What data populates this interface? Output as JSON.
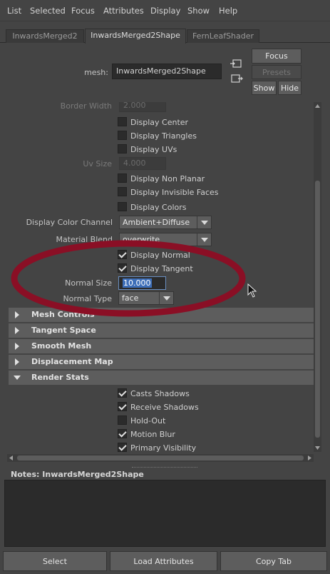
{
  "menubar": {
    "items": [
      "List",
      "Selected",
      "Focus",
      "Attributes",
      "Display",
      "Show",
      "Help"
    ]
  },
  "tabs": [
    "InwardsMerged2",
    "InwardsMerged2Shape",
    "FernLeafShader"
  ],
  "mesh": {
    "label": "mesh:",
    "value": "InwardsMerged2Shape"
  },
  "buttons": {
    "focus": "Focus",
    "presets": "Presets",
    "show": "Show",
    "hide": "Hide"
  },
  "attrs": {
    "border_width_label": "Border Width",
    "border_width_value": "2.000",
    "display_center": "Display Center",
    "display_triangles": "Display Triangles",
    "display_uvs": "Display UVs",
    "uv_size_label": "Uv Size",
    "uv_size_value": "4.000",
    "display_non_planar": "Display Non Planar",
    "display_invisible_faces": "Display Invisible Faces",
    "display_colors": "Display Colors",
    "display_color_channel_label": "Display Color Channel",
    "display_color_channel_value": "Ambient+Diffuse",
    "material_blend_label": "Material Blend",
    "material_blend_value": "overwrite",
    "display_normal": "Display Normal",
    "display_tangent": "Display Tangent",
    "normal_size_label": "Normal Size",
    "normal_size_value": "10.000",
    "normal_type_label": "Normal Type",
    "normal_type_value": "face"
  },
  "sections": [
    "Mesh Controls",
    "Tangent Space",
    "Smooth Mesh",
    "Displacement Map",
    "Render Stats"
  ],
  "render_stats": [
    "Casts Shadows",
    "Receive Shadows",
    "Hold-Out",
    "Motion Blur",
    "Primary Visibility"
  ],
  "notes": {
    "label": "Notes:",
    "value": "InwardsMerged2Shape"
  },
  "bottom": {
    "select": "Select",
    "load": "Load Attributes",
    "copy": "Copy Tab"
  },
  "colors": {
    "annotation": "#8a0f25",
    "background": "#444444",
    "field": "#2b2b2b"
  }
}
